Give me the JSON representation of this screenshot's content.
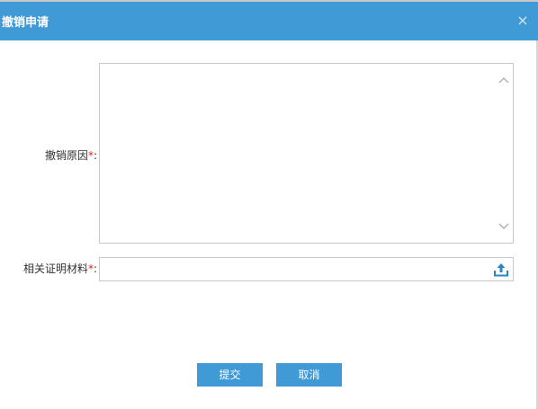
{
  "dialog": {
    "title": "撤销申请",
    "close_symbol": "×"
  },
  "form": {
    "reason": {
      "label": "撤销原因",
      "required_mark": "*",
      "colon": ":",
      "value": ""
    },
    "material": {
      "label": "相关证明材料",
      "required_mark": "*",
      "colon": ":",
      "value": ""
    }
  },
  "buttons": {
    "submit_label": "提交",
    "cancel_label": "取消"
  },
  "icons": {
    "close": "close-icon",
    "scroll_up": "chevron-up-icon",
    "scroll_down": "chevron-down-icon",
    "upload": "upload-icon"
  },
  "colors": {
    "header": "#3f9ad5",
    "button": "#3f9ad5",
    "required": "#e32020"
  }
}
